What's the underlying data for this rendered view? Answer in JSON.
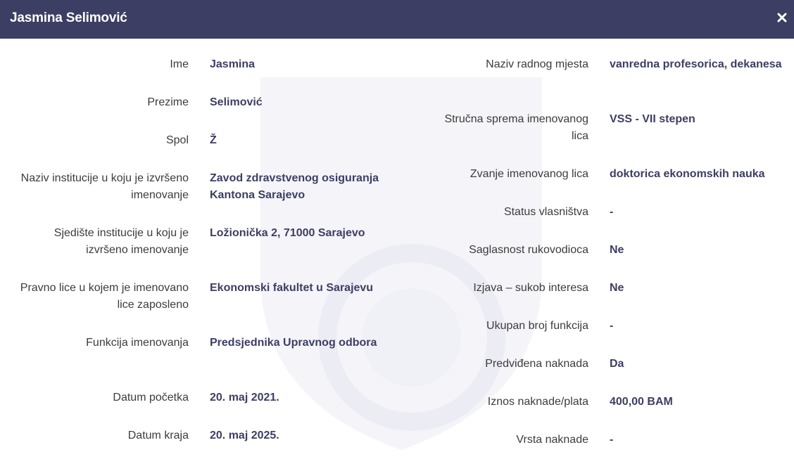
{
  "header": {
    "title": "Jasmina Selimović",
    "close_icon": "close-icon"
  },
  "colors": {
    "header_bg": "#3d3e63",
    "value_text": "#3d3e63",
    "label_text": "#3c3c3c"
  },
  "left_fields": [
    {
      "label": "Ime",
      "value": "Jasmina"
    },
    {
      "label": "Prezime",
      "value": "Selimović"
    },
    {
      "label": "Spol",
      "value": "Ž"
    },
    {
      "label": "Naziv institucije u koju je izvršeno imenovanje",
      "value": "Zavod zdravstvenog osiguranja Kantona Sarajevo"
    },
    {
      "label": "Sjedište institucije u koju je izvršeno imenovanje",
      "value": "Ložionička 2, 71000 Sarajevo"
    },
    {
      "label": "Pravno lice u kojem je imenovano lice zaposleno",
      "value": "Ekonomski fakultet u Sarajevu"
    },
    {
      "label": "Funkcija imenovanja",
      "value": "Predsjednika Upravnog odbora"
    },
    {
      "label": "Datum početka",
      "value": "20. maj 2021."
    },
    {
      "label": "Datum kraja",
      "value": "20. maj 2025."
    }
  ],
  "right_fields": [
    {
      "label": "Naziv radnog mjesta",
      "value": "vanredna profesorica, dekanesa"
    },
    {
      "label": "Stručna sprema imenovanog lica",
      "value": "VSS - VII stepen"
    },
    {
      "label": "Zvanje imenovanog lica",
      "value": "doktorica ekonomskih nauka"
    },
    {
      "label": "Status vlasništva",
      "value": "-"
    },
    {
      "label": "Saglasnost rukovodioca",
      "value": "Ne"
    },
    {
      "label": "Izjava – sukob interesa",
      "value": "Ne"
    },
    {
      "label": "Ukupan broj funkcija",
      "value": "-"
    },
    {
      "label": "Predviđena naknada",
      "value": "Da"
    },
    {
      "label": "Iznos naknade/plata",
      "value": "400,00 BAM"
    },
    {
      "label": "Vrsta naknade",
      "value": "-"
    }
  ]
}
